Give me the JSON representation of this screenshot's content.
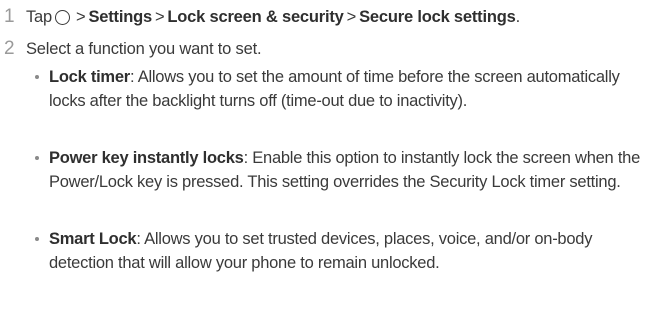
{
  "steps": [
    {
      "number": "1",
      "prefix": "Tap",
      "icon": "home-circle-icon",
      "path": [
        "Settings",
        "Lock screen & security",
        "Secure lock settings"
      ],
      "separator": ">",
      "suffix": "."
    },
    {
      "number": "2",
      "text": "Select a function you want to set."
    }
  ],
  "bullets": [
    {
      "term": "Lock timer",
      "description": ": Allows you to set the amount of time before the screen automatically locks after the backlight turns off (time-out due to inactivity)."
    },
    {
      "term": "Power key instantly locks",
      "description": ": Enable this option to instantly lock the screen when the Power/Lock key is pressed. This setting overrides the Security Lock timer setting."
    },
    {
      "term": "Smart Lock",
      "description": ": Allows you to set trusted devices, places, voice, and/or on-body detection that will allow your phone to remain unlocked."
    }
  ]
}
